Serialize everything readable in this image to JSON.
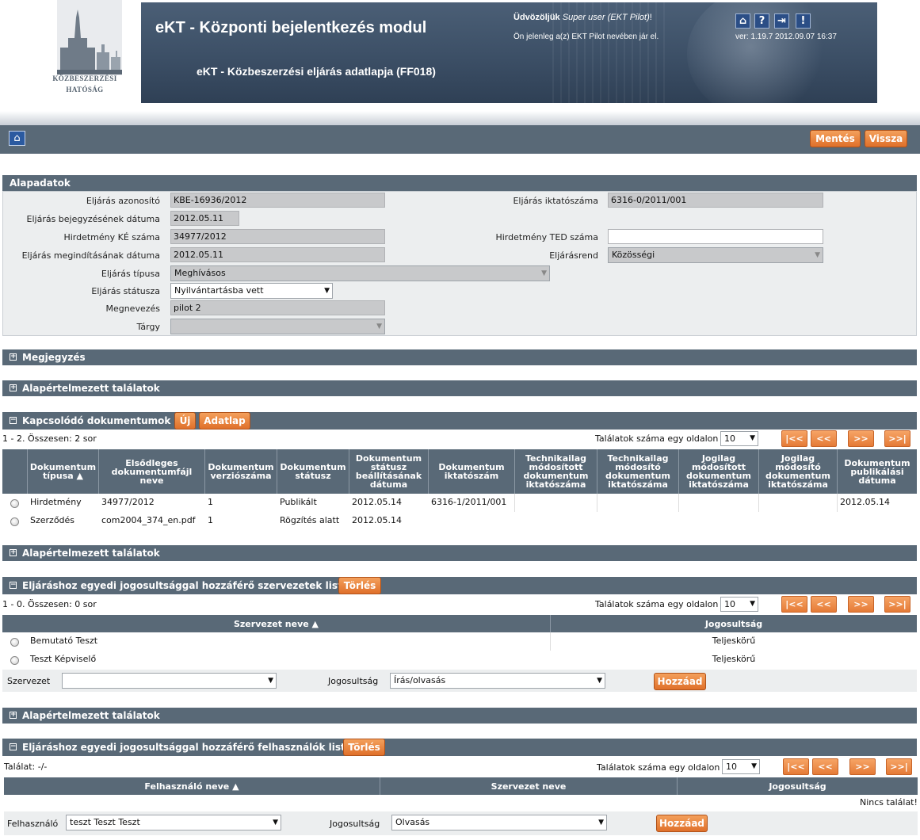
{
  "header": {
    "logo_line1": "Közbeszerzési",
    "logo_line2": "Hatóság",
    "app_title": "eKT - Központi bejelentkezés modul",
    "app_subtitle": "eKT - Közbeszerzési eljárás adatlapja (FF018)",
    "welcome_prefix": "Üdvözöljük",
    "welcome_user": "Super user (EKT Pilot)",
    "welcome_suffix": "!",
    "on_behalf": "Ön jelenleg a(z) EKT Pilot nevében jár el.",
    "version": "ver: 1.19.7 2012.09.07 16:37",
    "icons": [
      "home-icon",
      "help-icon",
      "logout-icon",
      "alert-icon"
    ]
  },
  "toolbar": {
    "save": "Mentés",
    "back": "Vissza"
  },
  "basic": {
    "title": "Alapadatok",
    "id_label": "Eljárás azonosító",
    "id_value": "KBE-16936/2012",
    "reg_label": "Eljárás iktatószáma",
    "reg_value": "6316-0/2011/001",
    "entry_date_label": "Eljárás bejegyzésének dátuma",
    "entry_date_value": "2012.05.11",
    "ke_label": "Hirdetmény KÉ száma",
    "ke_value": "34977/2012",
    "ted_label": "Hirdetmény TED száma",
    "ted_value": "",
    "start_label": "Eljárás megindításának dátuma",
    "start_value": "2012.05.11",
    "rend_label": "Eljárásrend",
    "rend_value": "Közösségi",
    "type_label": "Eljárás típusa",
    "type_value": "Meghívásos",
    "status_label": "Eljárás státusza",
    "status_value": "Nyilvántartásba vett",
    "name_label": "Megnevezés",
    "name_value": "pilot 2",
    "subject_label": "Tárgy",
    "subject_value": ""
  },
  "sections": {
    "note": "Megjegyzés",
    "default1": "Alapértelmezett találatok",
    "docs": "Kapcsolódó dokumentumok",
    "default2": "Alapértelmezett találatok",
    "orgs": "Eljáráshoz egyedi jogosultsággal hozzáférő szervezetek listája",
    "default3": "Alapértelmezett találatok",
    "users": "Eljáráshoz egyedi jogosultsággal hozzáférő felhasználók listája"
  },
  "docs": {
    "new_btn": "Új",
    "sheet_btn": "Adatlap",
    "count": "1 - 2. Összesen: 2 sor",
    "per_page_label": "Találatok száma egy oldalon",
    "per_page": "10",
    "pager": [
      "|<<",
      "<<",
      ">>",
      ">>|"
    ],
    "columns": [
      "Dokumentum típusa ▲",
      "Elsődleges dokumentumfájl neve",
      "Dokumentum verziószáma",
      "Dokumentum státusz",
      "Dokumentum státusz beállításának dátuma",
      "Dokumentum iktatószám",
      "Technikailag módosított dokumentum iktatószáma",
      "Technikailag módosító dokumentum iktatószáma",
      "Jogilag módosított dokumentum iktatószáma",
      "Jogilag módosító dokumentum iktatószáma",
      "Dokumentum publikálási dátuma"
    ],
    "rows": [
      [
        "Hirdetmény",
        "34977/2012",
        "1",
        "Publikált",
        "2012.05.14",
        "6316-1/2011/001",
        "",
        "",
        "",
        "",
        "2012.05.14"
      ],
      [
        "Szerződés",
        "com2004_374_en.pdf",
        "1",
        "Rögzítés alatt",
        "2012.05.14",
        "",
        "",
        "",
        "",
        "",
        ""
      ]
    ]
  },
  "orgs": {
    "delete_btn": "Törlés",
    "count": "1 - 0. Összesen: 0 sor",
    "per_page_label": "Találatok száma egy oldalon",
    "per_page": "10",
    "pager": [
      "|<<",
      "<<",
      ">>",
      ">>|"
    ],
    "columns": [
      "Szervezet neve ▲",
      "Jogosultság"
    ],
    "rows": [
      [
        "Bemutató Teszt",
        "Teljeskörű"
      ],
      [
        "Teszt Képviselő",
        "Teljeskörű"
      ]
    ],
    "org_label": "Szervezet",
    "org_value": "",
    "perm_label": "Jogosultság",
    "perm_value": "Írás/olvasás",
    "add_btn": "Hozzáad"
  },
  "users": {
    "delete_btn": "Törlés",
    "count": "Találat: -/-",
    "per_page_label": "Találatok száma egy oldalon",
    "per_page": "10",
    "pager": [
      "|<<",
      "<<",
      ">>",
      ">>|"
    ],
    "columns": [
      "Felhasználó neve ▲",
      "Szervezet neve",
      "Jogosultság"
    ],
    "no_result": "Nincs találat!",
    "user_label": "Felhasználó",
    "user_value": "teszt Teszt Teszt",
    "perm_label": "Jogosultság",
    "perm_value": "Olvasás",
    "add_btn": "Hozzáad"
  }
}
